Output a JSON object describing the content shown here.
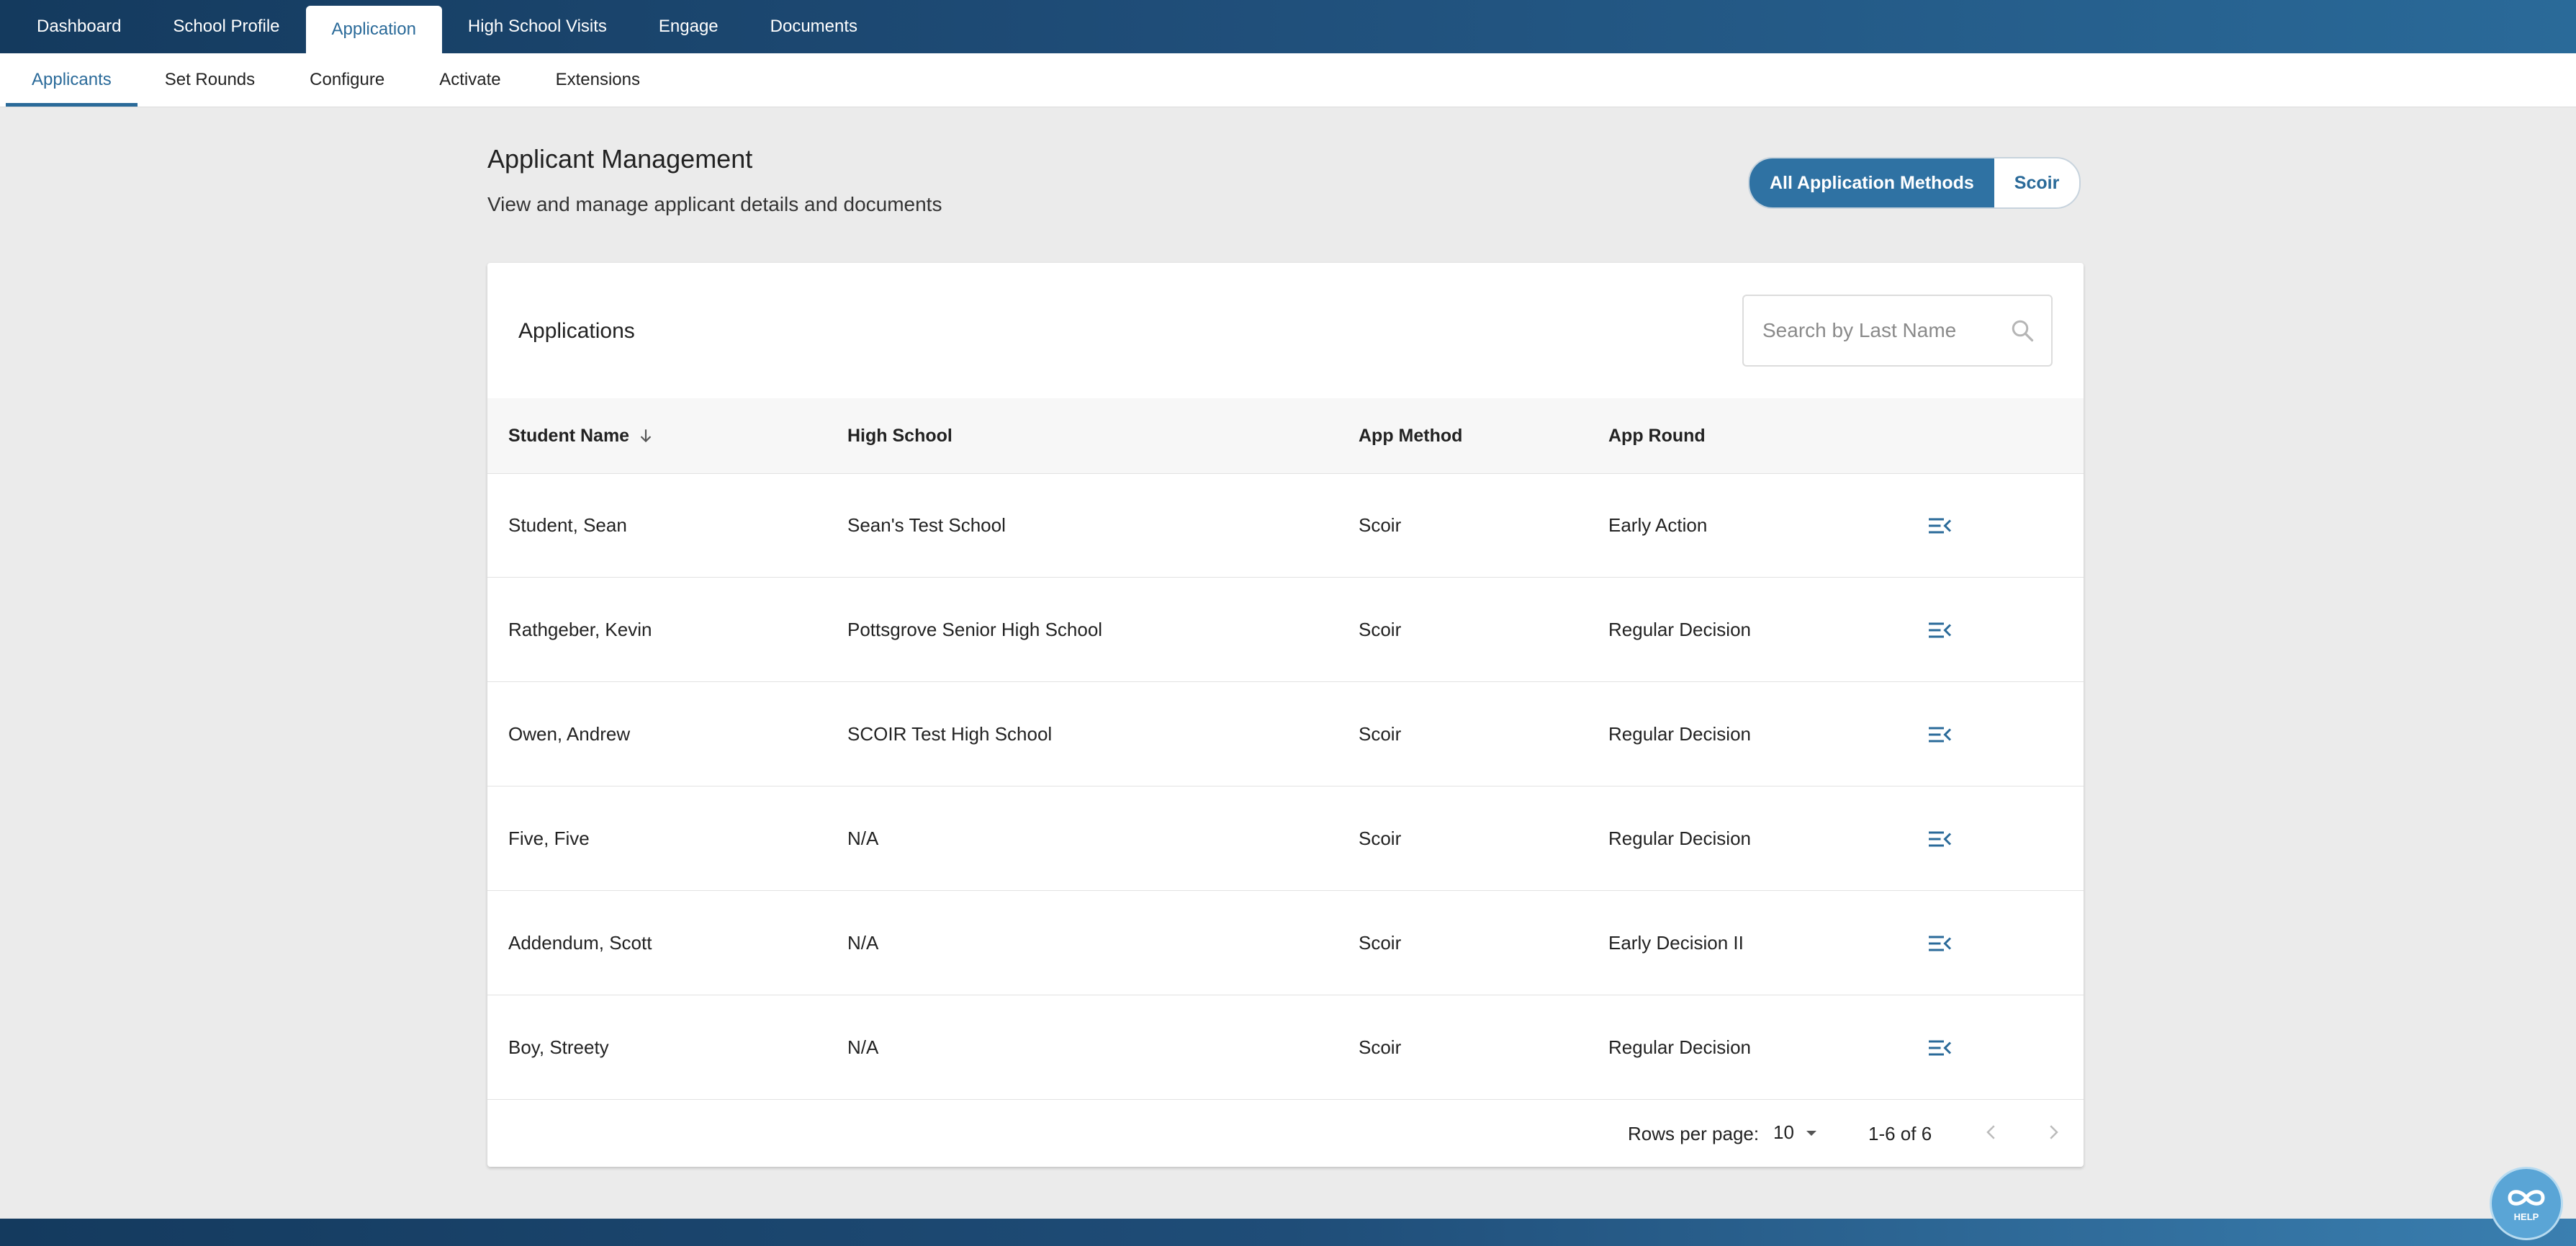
{
  "top_nav": {
    "tabs": [
      {
        "label": "Dashboard",
        "active": false
      },
      {
        "label": "School Profile",
        "active": false
      },
      {
        "label": "Application",
        "active": true
      },
      {
        "label": "High School Visits",
        "active": false
      },
      {
        "label": "Engage",
        "active": false
      },
      {
        "label": "Documents",
        "active": false
      }
    ]
  },
  "sub_nav": {
    "tabs": [
      {
        "label": "Applicants",
        "active": true
      },
      {
        "label": "Set Rounds",
        "active": false
      },
      {
        "label": "Configure",
        "active": false
      },
      {
        "label": "Activate",
        "active": false
      },
      {
        "label": "Extensions",
        "active": false
      }
    ]
  },
  "header": {
    "title": "Applicant Management",
    "subtitle": "View and manage applicant details and documents",
    "method_toggle": {
      "options": [
        "All Application Methods",
        "Scoir"
      ],
      "selected": "All Application Methods"
    }
  },
  "applications": {
    "title": "Applications",
    "search": {
      "placeholder": "Search by Last Name",
      "value": ""
    },
    "columns": {
      "student_name": "Student Name",
      "high_school": "High School",
      "app_method": "App Method",
      "app_round": "App Round"
    },
    "sort": {
      "column": "Student Name",
      "direction": "descending"
    },
    "rows": [
      {
        "student_name": "Student, Sean",
        "high_school": "Sean's Test School",
        "app_method": "Scoir",
        "app_round": "Early Action"
      },
      {
        "student_name": "Rathgeber, Kevin",
        "high_school": "Pottsgrove Senior High School",
        "app_method": "Scoir",
        "app_round": "Regular Decision"
      },
      {
        "student_name": "Owen, Andrew",
        "high_school": "SCOIR Test High School",
        "app_method": "Scoir",
        "app_round": "Regular Decision"
      },
      {
        "student_name": "Five, Five",
        "high_school": "N/A",
        "app_method": "Scoir",
        "app_round": "Regular Decision"
      },
      {
        "student_name": "Addendum, Scott",
        "high_school": "N/A",
        "app_method": "Scoir",
        "app_round": "Early Decision II"
      },
      {
        "student_name": "Boy, Streety",
        "high_school": "N/A",
        "app_method": "Scoir",
        "app_round": "Regular Decision"
      }
    ],
    "pagination": {
      "rows_per_page_label": "Rows per page:",
      "rows_per_page": "10",
      "range": "1-6 of 6"
    }
  },
  "help": {
    "label": "HELP"
  },
  "colors": {
    "accent": "#2a6a99",
    "nav_dark": "#143a5e",
    "toggle_active": "#2f72a3",
    "page_bg": "#ebebeb"
  },
  "icons": {
    "row_action": "list-detail-icon",
    "search": "search-icon",
    "sort": "arrow-down-icon",
    "help": "infinity-help-icon"
  }
}
